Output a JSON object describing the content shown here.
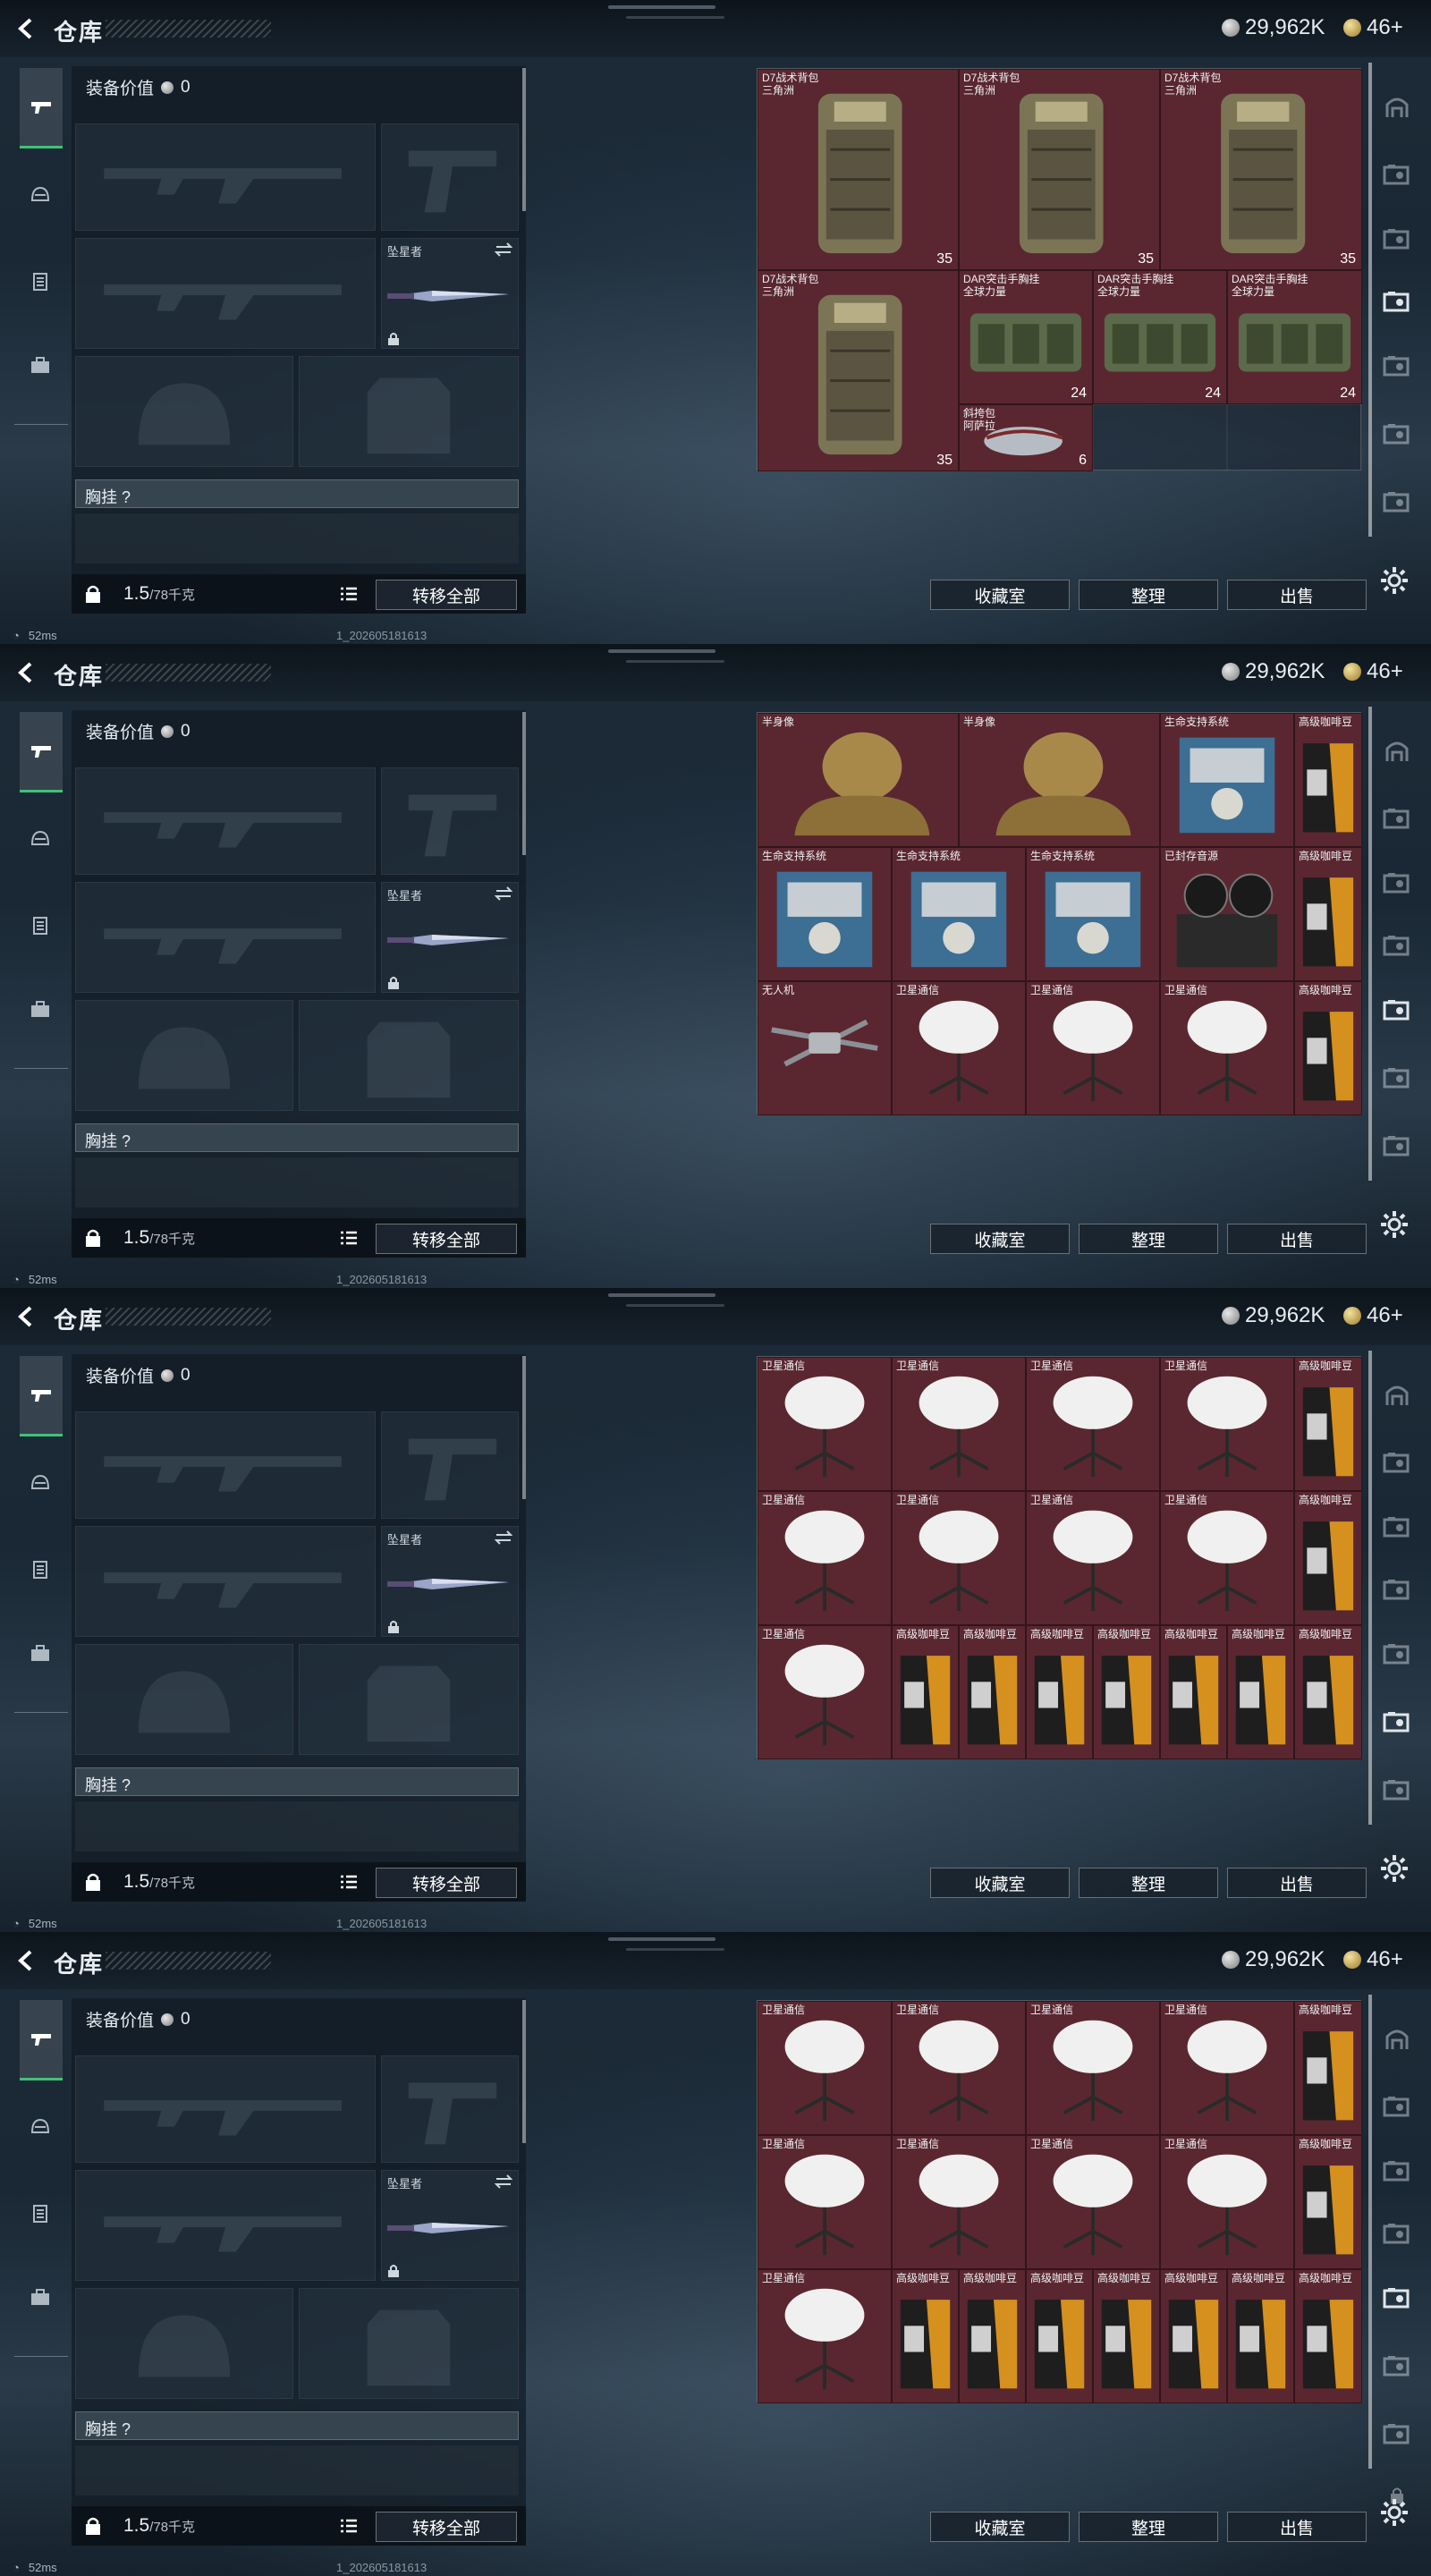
{
  "header": {
    "title": "仓库",
    "silver_amount": "29,962K",
    "gold_amount": "46+"
  },
  "loadout": {
    "equip_value_label": "装备价值",
    "equip_value": "0",
    "melee_slot_label": "坠星者",
    "chest_rig_label": "胸挂 ?",
    "weight_current": "1.5",
    "weight_max": "/78千克",
    "transfer_all": "转移全部"
  },
  "actions": {
    "collection": "收藏室",
    "sort": "整理",
    "sell": "出售"
  },
  "status": {
    "ping": "52ms",
    "build_id": "1_202605181613"
  },
  "screens": [
    {
      "items": [
        {
          "name": "D7战术背包",
          "sub": "三角洲",
          "count": "35",
          "art": "backpack"
        },
        {
          "name": "D7战术背包",
          "sub": "三角洲",
          "count": "35",
          "art": "backpack"
        },
        {
          "name": "D7战术背包",
          "sub": "三角洲",
          "count": "35",
          "art": "backpack"
        },
        {
          "name": "D7战术背包",
          "sub": "三角洲",
          "count": "35",
          "art": "backpack"
        },
        {
          "name": "DAR突击手胸挂",
          "sub": "全球力量",
          "count": "24",
          "art": "rig"
        },
        {
          "name": "DAR突击手胸挂",
          "sub": "全球力量",
          "count": "24",
          "art": "rig"
        },
        {
          "name": "DAR突击手胸挂",
          "sub": "全球力量",
          "count": "24",
          "art": "rig"
        },
        {
          "name": "斜挎包",
          "sub": "阿萨拉",
          "count": "6",
          "art": "sling"
        }
      ]
    },
    {
      "items": [
        {
          "name": "半身像",
          "art": "bust"
        },
        {
          "name": "半身像",
          "art": "bust"
        },
        {
          "name": "生命支持系统",
          "art": "lifesupport"
        },
        {
          "name": "高级咖啡豆",
          "art": "coffee"
        },
        {
          "name": "生命支持系统",
          "art": "lifesupport"
        },
        {
          "name": "生命支持系统",
          "art": "lifesupport"
        },
        {
          "name": "生命支持系统",
          "art": "lifesupport"
        },
        {
          "name": "已封存音源",
          "art": "reel"
        },
        {
          "name": "高级咖啡豆",
          "art": "coffee"
        },
        {
          "name": "无人机",
          "art": "drone"
        },
        {
          "name": "卫星通信",
          "art": "dish"
        },
        {
          "name": "卫星通信",
          "art": "dish"
        },
        {
          "name": "卫星通信",
          "art": "dish"
        },
        {
          "name": "高级咖啡豆",
          "art": "coffee"
        }
      ]
    },
    {
      "items": [
        {
          "name": "卫星通信",
          "art": "dish"
        },
        {
          "name": "卫星通信",
          "art": "dish"
        },
        {
          "name": "卫星通信",
          "art": "dish"
        },
        {
          "name": "卫星通信",
          "art": "dish"
        },
        {
          "name": "高级咖啡豆",
          "art": "coffee"
        },
        {
          "name": "卫星通信",
          "art": "dish"
        },
        {
          "name": "卫星通信",
          "art": "dish"
        },
        {
          "name": "卫星通信",
          "art": "dish"
        },
        {
          "name": "卫星通信",
          "art": "dish"
        },
        {
          "name": "高级咖啡豆",
          "art": "coffee"
        },
        {
          "name": "卫星通信",
          "art": "dish"
        },
        {
          "name": "高级咖啡豆",
          "art": "coffee"
        },
        {
          "name": "高级咖啡豆",
          "art": "coffee"
        },
        {
          "name": "高级咖啡豆",
          "art": "coffee"
        },
        {
          "name": "高级咖啡豆",
          "art": "coffee"
        },
        {
          "name": "高级咖啡豆",
          "art": "coffee"
        },
        {
          "name": "高级咖啡豆",
          "art": "coffee"
        },
        {
          "name": "高级咖啡豆",
          "art": "coffee"
        }
      ]
    },
    {
      "items": [
        {
          "name": "卫星通信",
          "art": "dish"
        },
        {
          "name": "卫星通信",
          "art": "dish"
        },
        {
          "name": "卫星通信",
          "art": "dish"
        },
        {
          "name": "卫星通信",
          "art": "dish"
        },
        {
          "name": "高级咖啡豆",
          "art": "coffee"
        },
        {
          "name": "卫星通信",
          "art": "dish"
        },
        {
          "name": "卫星通信",
          "art": "dish"
        },
        {
          "name": "卫星通信",
          "art": "dish"
        },
        {
          "name": "卫星通信",
          "art": "dish"
        },
        {
          "name": "高级咖啡豆",
          "art": "coffee"
        },
        {
          "name": "卫星通信",
          "art": "dish"
        },
        {
          "name": "高级咖啡豆",
          "art": "coffee"
        },
        {
          "name": "高级咖啡豆",
          "art": "coffee"
        },
        {
          "name": "高级咖啡豆",
          "art": "coffee"
        },
        {
          "name": "高级咖啡豆",
          "art": "coffee"
        },
        {
          "name": "高级咖啡豆",
          "art": "coffee"
        },
        {
          "name": "高级咖啡豆",
          "art": "coffee"
        },
        {
          "name": "高级咖啡豆",
          "art": "coffee"
        }
      ]
    }
  ],
  "colors": {
    "item_bg": "#5a2730",
    "accent_green": "#3ec27a"
  }
}
